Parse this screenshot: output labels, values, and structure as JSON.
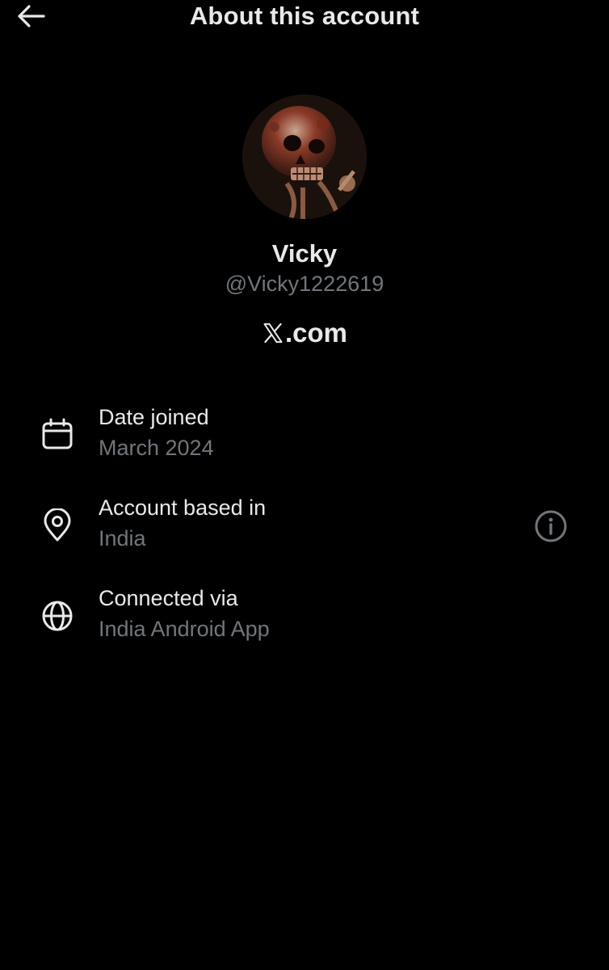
{
  "header": {
    "title": "About this account",
    "back_icon": "arrow-left-icon"
  },
  "profile": {
    "display_name": "Vicky",
    "handle": "@Vicky1222619",
    "avatar_description": "skeleton-avatar"
  },
  "brand": {
    "icon": "x-logo-icon",
    "text": ".com"
  },
  "details": [
    {
      "icon": "calendar-icon",
      "title": "Date joined",
      "value": "March 2024"
    },
    {
      "icon": "location-pin-icon",
      "title": "Account based in",
      "value": "India",
      "info_icon": "info-icon"
    },
    {
      "icon": "globe-icon",
      "title": "Connected via",
      "value": "India Android App"
    }
  ],
  "colors": {
    "background": "#000000",
    "primary_text": "#e7e9ea",
    "secondary_text": "#71767b"
  }
}
